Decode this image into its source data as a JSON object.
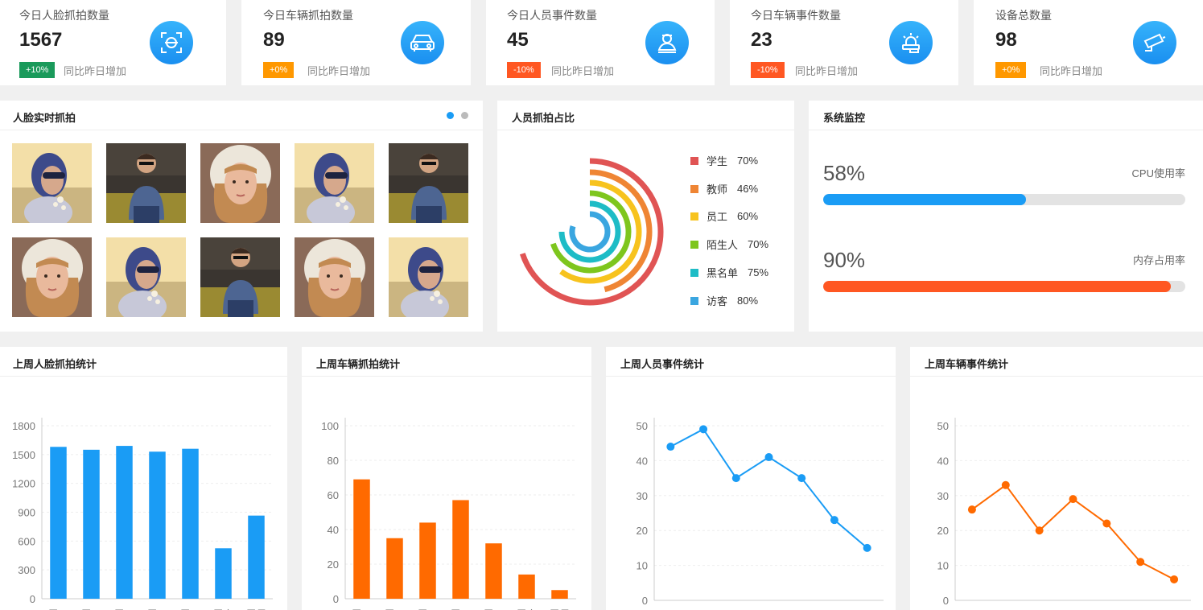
{
  "stats": [
    {
      "label": "今日人脸抓拍数量",
      "value": "1567",
      "badge": "+10%",
      "badge_color": "#1a9a5b",
      "compare": "同比昨日增加",
      "icon": "face-scan-icon"
    },
    {
      "label": "今日车辆抓拍数量",
      "value": "89",
      "badge": "+0%",
      "badge_color": "#ff9800",
      "compare": "同比昨日增加",
      "icon": "car-icon"
    },
    {
      "label": "今日人员事件数量",
      "value": "45",
      "badge": "-10%",
      "badge_color": "#ff5722",
      "compare": "同比昨日增加",
      "icon": "person-alert-icon"
    },
    {
      "label": "今日车辆事件数量",
      "value": "23",
      "badge": "-10%",
      "badge_color": "#ff5722",
      "compare": "同比昨日增加",
      "icon": "car-alarm-icon"
    },
    {
      "label": "设备总数量",
      "value": "98",
      "badge": "+0%",
      "badge_color": "#ff9800",
      "compare": "同比昨日增加",
      "icon": "camera-icon"
    }
  ],
  "face_panel": {
    "title": "人脸实时抓拍",
    "photos": [
      "woman-sunglasses",
      "man-glasses",
      "girl-hood",
      "woman-sunglasses",
      "man-glasses",
      "girl-hood",
      "woman-sunglasses",
      "man-glasses",
      "girl-hood",
      "woman-sunglasses"
    ]
  },
  "ratio_panel": {
    "title": "人员抓拍占比",
    "items": [
      {
        "name": "学生",
        "pct": "70%",
        "value": 70,
        "color": "#e05454"
      },
      {
        "name": "教师",
        "pct": "46%",
        "value": 46,
        "color": "#ef8534"
      },
      {
        "name": "员工",
        "pct": "60%",
        "value": 60,
        "color": "#f7c31e"
      },
      {
        "name": "陌生人",
        "pct": "70%",
        "value": 70,
        "color": "#7ec61e"
      },
      {
        "name": "黑名单",
        "pct": "75%",
        "value": 75,
        "color": "#1ebcc6"
      },
      {
        "name": "访客",
        "pct": "80%",
        "value": 80,
        "color": "#3aa6e0"
      }
    ]
  },
  "monitor_panel": {
    "title": "系统监控",
    "items": [
      {
        "value": "58%",
        "fraction": 0.56,
        "label": "CPU使用率",
        "color": "#1a9cf5"
      },
      {
        "value": "90%",
        "fraction": 0.96,
        "label": "内存占用率",
        "color": "#ff5722"
      }
    ]
  },
  "chart_data": [
    {
      "title": "上周人脸抓拍统计",
      "type": "bar",
      "color": "#1a9cf5",
      "categories": [
        "周一",
        "周二",
        "周三",
        "周四",
        "周五",
        "周六",
        "周日"
      ],
      "values": [
        1580,
        1550,
        1590,
        1530,
        1560,
        525,
        865
      ],
      "yticks": [
        0,
        300,
        600,
        900,
        1200,
        1500,
        1800
      ],
      "ylim": [
        0,
        1800
      ]
    },
    {
      "title": "上周车辆抓拍统计",
      "type": "bar",
      "color": "#ff6a00",
      "categories": [
        "周一",
        "周二",
        "周三",
        "周四",
        "周五",
        "周六",
        "周日"
      ],
      "values": [
        69,
        35,
        44,
        57,
        32,
        14,
        5
      ],
      "yticks": [
        0,
        20,
        40,
        60,
        80,
        100
      ],
      "ylim": [
        0,
        100
      ]
    },
    {
      "title": "上周人员事件统计",
      "type": "line",
      "color": "#1a9cf5",
      "categories": [
        "周一",
        "周二",
        "周三",
        "周四",
        "周五",
        "周六",
        "周日"
      ],
      "values": [
        44,
        49,
        35,
        41,
        35,
        23,
        15
      ],
      "yticks": [
        0,
        10,
        20,
        30,
        40,
        50
      ],
      "ylim": [
        0,
        50
      ]
    },
    {
      "title": "上周车辆事件统计",
      "type": "line",
      "color": "#ff6a00",
      "categories": [
        "周一",
        "周二",
        "周三",
        "周四",
        "周五",
        "周六",
        "周日"
      ],
      "values": [
        26,
        33,
        20,
        29,
        22,
        11,
        6
      ],
      "yticks": [
        0,
        10,
        20,
        30,
        40,
        50
      ],
      "ylim": [
        0,
        50
      ]
    }
  ]
}
